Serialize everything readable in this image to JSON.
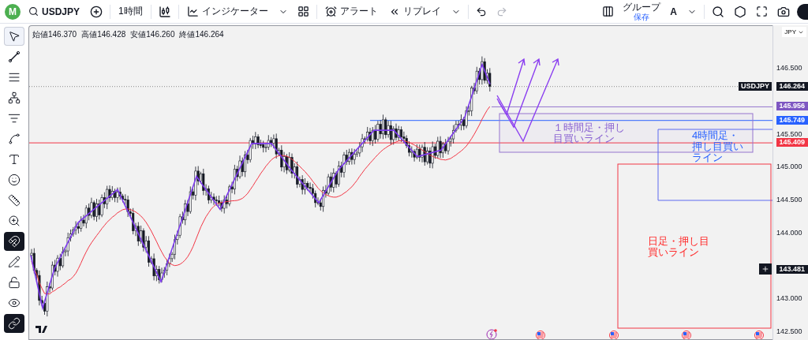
{
  "top_toolbar": {
    "avatar": "M",
    "symbol": "USDJPY",
    "interval": "1時間",
    "indicators": "インジケーター",
    "alert": "アラート",
    "replay": "リプレイ",
    "layout": "グループ",
    "layout_status": "保存",
    "font_letter": "A"
  },
  "left_tools": [
    {
      "selected": true,
      "on": false
    },
    {
      "selected": false,
      "on": false
    },
    {
      "selected": false,
      "on": false
    },
    {
      "selected": false,
      "on": false
    },
    {
      "selected": false,
      "on": false
    },
    {
      "selected": false,
      "on": false
    },
    {
      "selected": false,
      "on": false
    },
    {
      "selected": false,
      "on": false
    },
    {
      "selected": false,
      "on": false
    },
    {
      "selected": false,
      "on": false
    },
    {
      "selected": false,
      "on": true
    },
    {
      "selected": false,
      "on": false
    },
    {
      "selected": false,
      "on": false
    },
    {
      "selected": false,
      "on": false
    },
    {
      "selected": false,
      "on": true
    }
  ],
  "ohlc": [
    {
      "label": "始値",
      "value": "146.370"
    },
    {
      "label": "高値",
      "value": "146.428"
    },
    {
      "label": "安値",
      "value": "146.260"
    },
    {
      "label": "終値",
      "value": "146.264"
    }
  ],
  "price_axis": {
    "currency": "JPY",
    "ticks": [
      "146.500",
      "145.500",
      "145.000",
      "144.500",
      "144.000",
      "143.000",
      "142.500"
    ],
    "badges": [
      {
        "kind": "symbol",
        "symbol": "USDJPY",
        "value": "146.264",
        "color": "#131722"
      },
      {
        "kind": "line",
        "value": "145.956",
        "color": "#7e57c2"
      },
      {
        "kind": "line",
        "value": "145.749",
        "color": "#2962ff"
      },
      {
        "kind": "line",
        "value": "145.409",
        "color": "#f23645"
      },
      {
        "kind": "crosshair",
        "value": "143.481",
        "color": "#131722"
      }
    ]
  },
  "annotations": [
    {
      "text": "１時間足・押し目買いライン",
      "color": "#8a63d2"
    },
    {
      "text": "4時間足・押し目買いライン",
      "color": "#2962ff"
    },
    {
      "text": "日足・押し目買いライン",
      "color": "#ff2a2a"
    }
  ],
  "events": [
    {
      "kind": "flash"
    },
    {
      "kind": "flag"
    },
    {
      "kind": "flag"
    },
    {
      "kind": "flag"
    },
    {
      "kind": "flag"
    }
  ]
}
